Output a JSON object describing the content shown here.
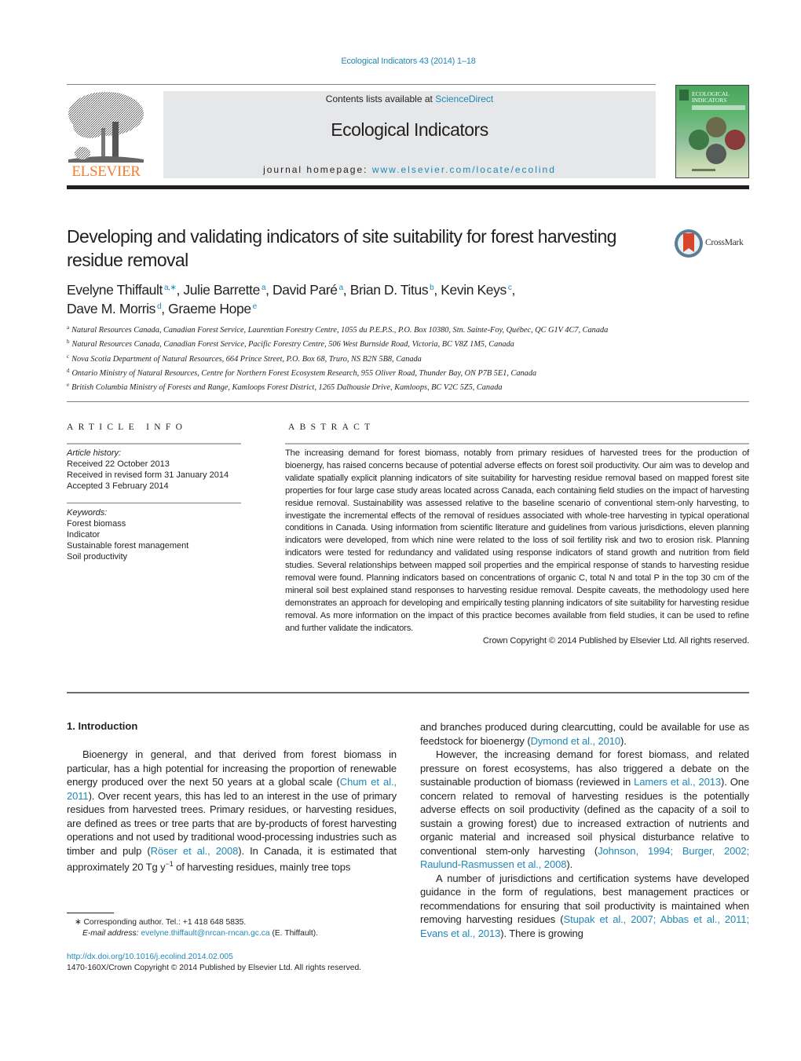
{
  "header": {
    "journal_ref": "Ecological Indicators 43 (2014) 1–18",
    "contents_prefix": "Contents lists available at ",
    "contents_link": "ScienceDirect",
    "journal_name": "Ecological Indicators",
    "homepage_prefix": "journal homepage: ",
    "homepage_link": "www.elsevier.com/locate/ecolind",
    "publisher_logo_text": "ELSEVIER",
    "cover_title_line1": "ECOLOGICAL",
    "cover_title_line2": "INDICATORS",
    "crossmark_label": "CrossMark",
    "colors": {
      "link": "#1f88b8",
      "elsevier_orange": "#f47d30",
      "masthead_bg": "#e6e7e8"
    }
  },
  "article": {
    "title": "Developing and validating indicators of site suitability for forest harvesting residue removal",
    "authors": [
      {
        "name": "Evelyne Thiffault",
        "sup": "a,∗",
        "sep": ", "
      },
      {
        "name": "Julie Barrette",
        "sup": "a",
        "sep": ", "
      },
      {
        "name": "David Paré",
        "sup": "a",
        "sep": ", "
      },
      {
        "name": "Brian D. Titus",
        "sup": "b",
        "sep": ", "
      },
      {
        "name": "Kevin Keys",
        "sup": "c",
        "sep": ","
      },
      {
        "name": "Dave M. Morris",
        "sup": "d",
        "sep": ", "
      },
      {
        "name": "Graeme Hope",
        "sup": "e",
        "sep": ""
      }
    ],
    "affiliations": [
      {
        "key": "a",
        "text": "Natural Resources Canada, Canadian Forest Service, Laurentian Forestry Centre, 1055 du P.E.P.S., P.O. Box 10380, Stn. Sainte-Foy, Québec, QC G1V 4C7, Canada"
      },
      {
        "key": "b",
        "text": "Natural Resources Canada, Canadian Forest Service, Pacific Forestry Centre, 506 West Burnside Road, Victoria, BC V8Z 1M5, Canada"
      },
      {
        "key": "c",
        "text": "Nova Scotia Department of Natural Resources, 664 Prince Street, P.O. Box 68, Truro, NS B2N 5B8, Canada"
      },
      {
        "key": "d",
        "text": "Ontario Ministry of Natural Resources, Centre for Northern Forest Ecosystem Research, 955 Oliver Road, Thunder Bay, ON P7B 5E1, Canada"
      },
      {
        "key": "e",
        "text": "British Columbia Ministry of Forests and Range, Kamloops Forest District, 1265 Dalhousie Drive, Kamloops, BC V2C 5Z5, Canada"
      }
    ]
  },
  "article_info": {
    "heading": "ARTICLE INFO",
    "history_label": "Article history:",
    "received": "Received 22 October 2013",
    "revised": "Received in revised form 31 January 2014",
    "accepted": "Accepted 3 February 2014",
    "keywords_label": "Keywords:",
    "keywords": [
      "Forest biomass",
      "Indicator",
      "Sustainable forest management",
      "Soil productivity"
    ]
  },
  "abstract": {
    "heading": "ABSTRACT",
    "text": "The increasing demand for forest biomass, notably from primary residues of harvested trees for the production of bioenergy, has raised concerns because of potential adverse effects on forest soil productivity. Our aim was to develop and validate spatially explicit planning indicators of site suitability for harvesting residue removal based on mapped forest site properties for four large case study areas located across Canada, each containing field studies on the impact of harvesting residue removal. Sustainability was assessed relative to the baseline scenario of conventional stem-only harvesting, to investigate the incremental effects of the removal of residues associated with whole-tree harvesting in typical operational conditions in Canada. Using information from scientific literature and guidelines from various jurisdictions, eleven planning indicators were developed, from which nine were related to the loss of soil fertility risk and two to erosion risk. Planning indicators were tested for redundancy and validated using response indicators of stand growth and nutrition from field studies. Several relationships between mapped soil properties and the empirical response of stands to harvesting residue removal were found. Planning indicators based on concentrations of organic C, total N and total P in the top 30 cm of the mineral soil best explained stand responses to harvesting residue removal. Despite caveats, the methodology used here demonstrates an approach for developing and empirically testing planning indicators of site suitability for harvesting residue removal. As more information on the impact of this practice becomes available from field studies, it can be used to refine and further validate the indicators.",
    "copyright": "Crown Copyright © 2014 Published by Elsevier Ltd. All rights reserved."
  },
  "introduction": {
    "heading": "1.  Introduction",
    "p1_a": "Bioenergy in general, and that derived from forest biomass in particular, has a high potential for increasing the proportion of renewable energy produced over the next 50 years at a global scale (",
    "p1_cite1": "Chum et al., 2011",
    "p1_b": "). Over recent years, this has led to an interest in the use of primary residues from harvested trees. Primary residues, or harvesting residues, are defined as trees or tree parts that are by-products of forest harvesting operations and not used by traditional wood-processing industries such as timber and pulp (",
    "p1_cite2": "Röser et al., 2008",
    "p1_c": "). In Canada, it is estimated that approximately 20 Tg y",
    "p1_sup": "−1",
    "p1_d": " of harvesting residues, mainly tree tops",
    "r1_a": "and branches produced during clearcutting, could be available for use as feedstock for bioenergy (",
    "r1_cite": "Dymond et al., 2010",
    "r1_b": ").",
    "p2_a": "However, the increasing demand for forest biomass, and related pressure on forest ecosystems, has also triggered a debate on the sustainable production of biomass (reviewed in ",
    "p2_cite1": "Lamers et al., 2013",
    "p2_b": "). One concern related to removal of harvesting residues is the potentially adverse effects on soil productivity (defined as the capacity of a soil to sustain a growing forest) due to increased extraction of nutrients and organic material and increased soil physical disturbance relative to conventional stem-only harvesting (",
    "p2_cite2": "Johnson, 1994; Burger, 2002; Raulund-Rasmussen et al., 2008",
    "p2_c": ").",
    "p3_a": "A number of jurisdictions and certification systems have developed guidance in the form of regulations, best management practices or recommendations for ensuring that soil productivity is maintained when removing harvesting residues (",
    "p3_cite": "Stupak et al., 2007; Abbas et al., 2011; Evans et al., 2013",
    "p3_b": "). There is growing"
  },
  "footnotes": {
    "corresponding": "∗  Corresponding author. Tel.: +1 418 648 5835.",
    "email_label": "E-mail address: ",
    "email": "evelyne.thiffault@nrcan-rncan.gc.ca",
    "email_suffix": " (E. Thiffault).",
    "doi": "http://dx.doi.org/10.1016/j.ecolind.2014.02.005",
    "issn": "1470-160X/Crown Copyright © 2014 Published by Elsevier Ltd. All rights reserved."
  }
}
